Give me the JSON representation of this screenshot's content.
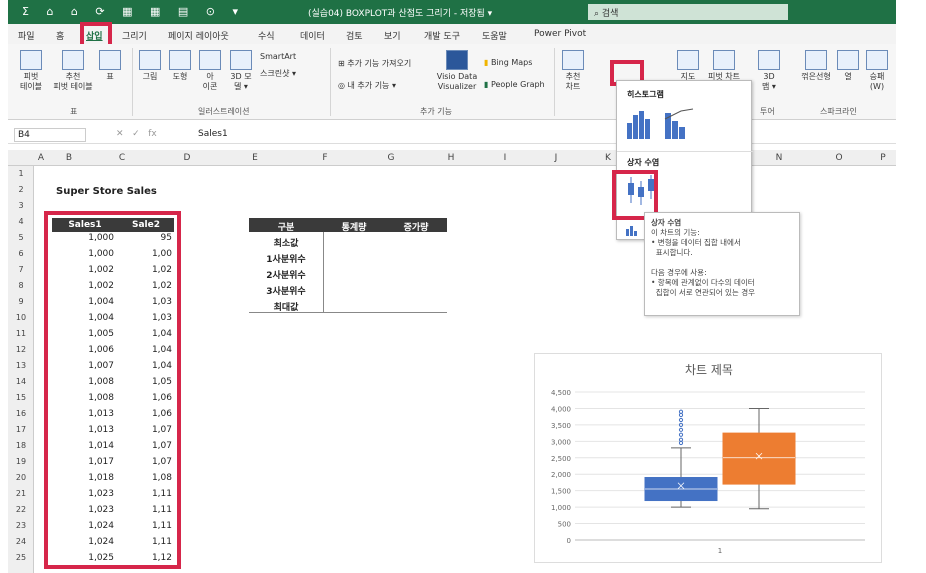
{
  "titlebar": {
    "qat": "Σ ⌂ ⌂ ⟳ ▦ ▦ ▤ ⊙ ▾",
    "title": "(실습04) BOXPLOT과 산점도 그리기 - 저장됨 ▾",
    "search_placeholder": "검색",
    "accent": "#1f7145"
  },
  "tabs": [
    {
      "label": "파일"
    },
    {
      "label": "홈"
    },
    {
      "label": "삽입"
    },
    {
      "label": "그리기"
    },
    {
      "label": "페이지 레이아웃"
    },
    {
      "label": "수식"
    },
    {
      "label": "데이터"
    },
    {
      "label": "검토"
    },
    {
      "label": "보기"
    },
    {
      "label": "개발 도구"
    },
    {
      "label": "도움말"
    },
    {
      "label": "Power Pivot"
    }
  ],
  "ribbon": {
    "pivot": "피벗\n테이블",
    "recommended_pivot": "추천\n피벗 테이블",
    "table": "표",
    "picture": "그림",
    "shapes": "도형",
    "icons": "아\n이콘",
    "models3d": "3D 모\n델 ▾",
    "smartart": "SmartArt",
    "screenshot": "스크린샷 ▾",
    "get_addins": "추가 기능 가져오기",
    "my_addins": "내 추가 기능 ▾",
    "visio": "Visio Data\nVisualizer",
    "bing": "Bing Maps",
    "people": "People Graph",
    "rec_charts": "추천\n차트",
    "maps": "지도",
    "pivot_chart": "피벗 차트",
    "map3d": "3D\n맵 ▾",
    "line": "꺾은선형",
    "column": "열",
    "winloss": "승패\n(W)",
    "group_table": "표",
    "group_illustrations": "일러스트레이션",
    "group_addins": "추가 기능",
    "group_tours": "투어",
    "group_sparklines": "스파크라인"
  },
  "formula_bar": {
    "name_box": "B4",
    "fx": "fx",
    "value": "Sales1"
  },
  "columns": [
    "A",
    "B",
    "C",
    "D",
    "E",
    "F",
    "G",
    "H",
    "I",
    "J",
    "K",
    "L",
    "M",
    "N",
    "O",
    "P"
  ],
  "rows": [
    "1",
    "2",
    "3",
    "4",
    "5",
    "6",
    "7",
    "8",
    "9",
    "10",
    "11",
    "12",
    "13",
    "14",
    "15",
    "16",
    "17",
    "18",
    "19",
    "20",
    "21",
    "22",
    "23",
    "24",
    "25"
  ],
  "sheet": {
    "title": "Super Store Sales",
    "headers": [
      "Sales1",
      "Sale2"
    ],
    "sales1": [
      "1,000",
      "1,000",
      "1,002",
      "1,002",
      "1,004",
      "1,004",
      "1,005",
      "1,006",
      "1,007",
      "1,008",
      "1,008",
      "1,013",
      "1,013",
      "1,014",
      "1,017",
      "1,018",
      "1,023",
      "1,023",
      "1,024",
      "1,024",
      "1,025"
    ],
    "sales2": [
      "95",
      "1,00",
      "1,02",
      "1,02",
      "1,03",
      "1,03",
      "1,04",
      "1,04",
      "1,04",
      "1,05",
      "1,06",
      "1,06",
      "1,07",
      "1,07",
      "1,07",
      "1,08",
      "1,11",
      "1,11",
      "1,11",
      "1,11",
      "1,12"
    ]
  },
  "stats_table": {
    "headers": [
      "구분",
      "통계량",
      "증가량"
    ],
    "rows": [
      "최소값",
      "1사분위수",
      "2사분위수",
      "3사분위수",
      "최대값"
    ]
  },
  "popup": {
    "histogram_title": "히스토그램",
    "boxwhisker_title": "상자 수염"
  },
  "tooltip": {
    "title": "상자 수염",
    "lines": [
      "이 차트의 기능:",
      "• 변형을 데이터 집합 내에서",
      "  표시합니다.",
      "",
      "다음 경우에 사용:",
      "• 항목에 관계없이 다수의 데이터",
      "  집합이 서로 연관되어 있는 경우"
    ]
  },
  "chart_data": {
    "type": "box",
    "title": "차트 제목",
    "categories": [
      "1"
    ],
    "ylim": [
      0,
      4500
    ],
    "yticks": [
      "0",
      "500",
      "1,000",
      "1,500",
      "2,000",
      "2,500",
      "3,000",
      "3,500",
      "4,000",
      "4,500"
    ],
    "series": [
      {
        "color": "#4472c4",
        "min": 1000,
        "q1": 1200,
        "median": 1550,
        "q3": 1900,
        "max": 2800,
        "mean": 1650,
        "outliers": [
          2950,
          3050,
          3200,
          3350,
          3500,
          3650,
          3800,
          3900
        ]
      },
      {
        "color": "#ed7d31",
        "min": 950,
        "q1": 1700,
        "median": 2500,
        "q3": 3250,
        "max": 4000,
        "mean": 2550,
        "outliers": []
      }
    ]
  }
}
